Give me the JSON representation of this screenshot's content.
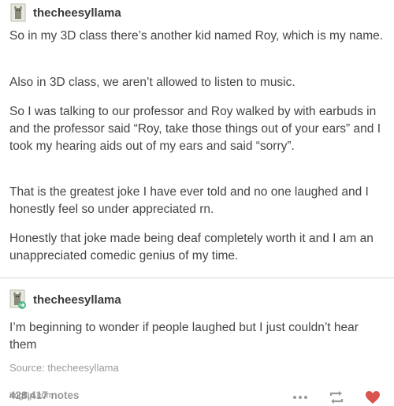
{
  "post": {
    "author": "thecheesyllama",
    "paragraphs": [
      "So in my 3D class there’s another kid named Roy, which is my name.",
      "Also in 3D class, we aren’t allowed to listen to music.",
      "So I was talking to our professor and Roy walked by with earbuds in and the professor said “Roy, take those things out of your ears” and I took my hearing aids out of my ears and said “sorry”.",
      "That is the greatest joke I have ever told and no one laughed and I honestly feel so under appreciated rn.",
      "Honestly that joke made being deaf completely worth it and I am an unappreciated comedic genius of my time."
    ]
  },
  "reply": {
    "author": "thecheesyllama",
    "text": "I’m beginning to wonder if people laughed but I just couldn’t hear them"
  },
  "source": "Source: thecheesyllama",
  "footer": {
    "notes": "428,417 notes",
    "watermark": "imgflip.com",
    "icons": [
      "more-icon",
      "reblog-icon",
      "heart-icon"
    ],
    "heart_color": "#d9534f"
  }
}
